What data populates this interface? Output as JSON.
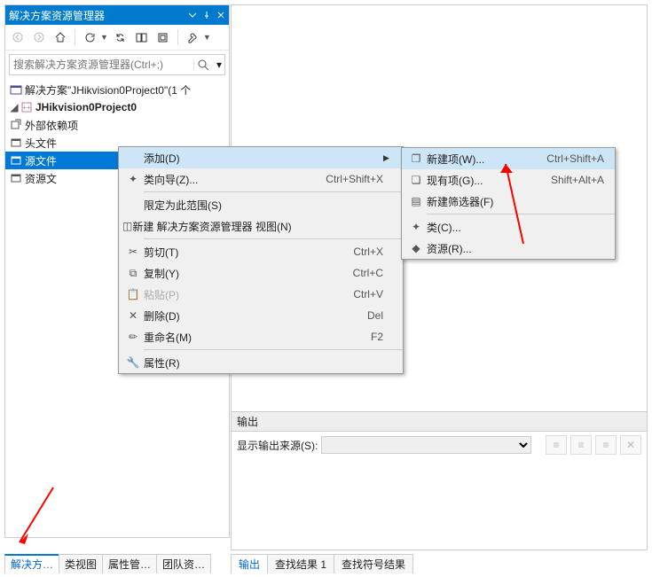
{
  "panel": {
    "title": "解决方案资源管理器",
    "search_placeholder": "搜索解决方案资源管理器(Ctrl+;)"
  },
  "tree": {
    "solution": "解决方案\"JHikvision0Project0\"(1 个",
    "project": "JHikvision0Project0",
    "ext_deps": "外部依赖项",
    "headers": "头文件",
    "sources": "源文件",
    "resources": "资源文"
  },
  "tabs_left": {
    "t1": "解决方…",
    "t2": "类视图",
    "t3": "属性管…",
    "t4": "团队资…"
  },
  "output": {
    "title": "输出",
    "src_label": "显示输出来源(S):"
  },
  "tabs_out": {
    "t1": "输出",
    "t2": "查找结果 1",
    "t3": "查找符号结果"
  },
  "menu1": {
    "add": "添加(D)",
    "wizard": "类向导(Z)...",
    "wizard_sc": "Ctrl+Shift+X",
    "scope": "限定为此范围(S)",
    "newview": "新建 解决方案资源管理器 视图(N)",
    "cut": "剪切(T)",
    "cut_sc": "Ctrl+X",
    "copy": "复制(Y)",
    "copy_sc": "Ctrl+C",
    "paste": "粘贴(P)",
    "paste_sc": "Ctrl+V",
    "delete": "删除(D)",
    "delete_sc": "Del",
    "rename": "重命名(M)",
    "rename_sc": "F2",
    "props": "属性(R)"
  },
  "menu2": {
    "newitem": "新建项(W)...",
    "newitem_sc": "Ctrl+Shift+A",
    "existing": "现有项(G)...",
    "existing_sc": "Shift+Alt+A",
    "filter": "新建筛选器(F)",
    "class": "类(C)...",
    "resource": "资源(R)..."
  }
}
